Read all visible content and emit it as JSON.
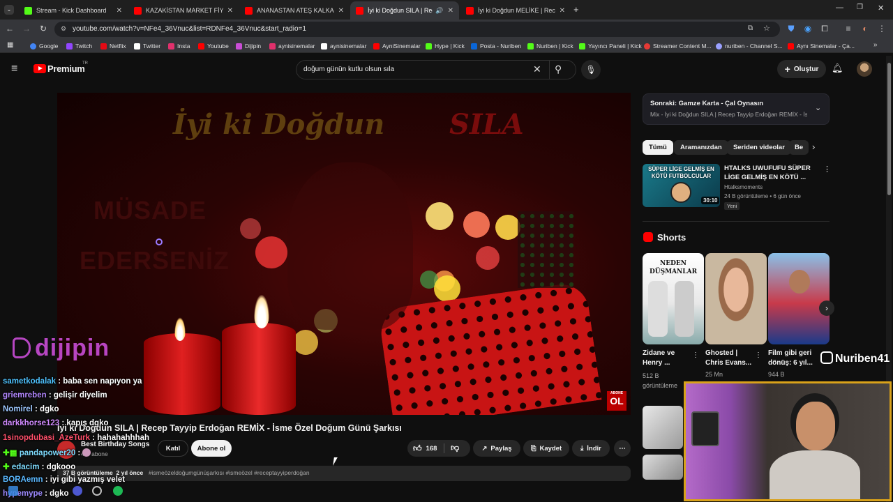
{
  "browser": {
    "tabs": [
      {
        "title": "Stream - Kick Dashboard",
        "color": "#53fc18"
      },
      {
        "title": "KAZAKİSTAN MARKET FİYATLARI",
        "color": "#ff0000"
      },
      {
        "title": "ANANASTAN ATEŞ KALKANI YAPTI",
        "color": "#ff0000"
      },
      {
        "title": "İyi ki Doğdun SILA | Recep",
        "color": "#ff0000",
        "active": true
      },
      {
        "title": "İyi ki Doğdun MELİKE | Recep Ta",
        "color": "#ff0000"
      }
    ],
    "url": "youtube.com/watch?v=NFe4_36Vnuc&list=RDNFe4_36Vnuc&start_radio=1",
    "bookmarks": [
      {
        "label": "Google",
        "color": "#4285f4"
      },
      {
        "label": "Twitch",
        "color": "#9146ff"
      },
      {
        "label": "Netflix",
        "color": "#e50914"
      },
      {
        "label": "Twitter",
        "color": "#ffffff"
      },
      {
        "label": "Insta",
        "color": "#e1306c"
      },
      {
        "label": "Youtube",
        "color": "#ff0000"
      },
      {
        "label": "Dijipin",
        "color": "#c94dd6"
      },
      {
        "label": "aynisinemalar",
        "color": "#e1306c"
      },
      {
        "label": "aynisinemalar",
        "color": "#ffffff"
      },
      {
        "label": "AyniSinemalar",
        "color": "#ff0000"
      },
      {
        "label": "Hype | Kick",
        "color": "#53fc18"
      },
      {
        "label": "Posta - Nuriben",
        "color": "#0a66d8"
      },
      {
        "label": "Nuriben | Kick",
        "color": "#53fc18"
      },
      {
        "label": "Yayıncı Paneli | Kick",
        "color": "#53fc18"
      },
      {
        "label": "Streamer Content M...",
        "color": "#e53935"
      },
      {
        "label": "nuriben - Channel S...",
        "color": "#9aa0ff"
      },
      {
        "label": "Aynı Sinemalar - Ça...",
        "color": "#ff0000"
      }
    ]
  },
  "youtube": {
    "logo": "Premium",
    "logo_badge": "TR",
    "search_query": "doğum günün kutlu olsun sıla",
    "create_label": "Oluştur",
    "video": {
      "overlay_title_1": "İyi ki Doğdun",
      "overlay_title_2": "SILA",
      "overlay_bg_text_1": "MÜSADE",
      "overlay_bg_text_2": "EDERSENİZ",
      "corner_logo_1": "ABONE",
      "corner_logo_2": "OL",
      "title": "İyi ki Doğdun SILA | Recep Tayyip Erdoğan REMİX - İsme Özel Doğum Günü Şarkısı",
      "channel": "Best Birthday Songs",
      "subscribers": "4 B abone",
      "join_label": "Katıl",
      "subscribe_label": "Abone ol",
      "likes": "168",
      "share_label": "Paylaş",
      "save_label": "Kaydet",
      "download_label": "İndir",
      "views_date": "37 B görüntüleme  2 yıl önce",
      "hashtags": "#ismeözeldoğumgünüşarkısı #ismeözel #receptayyiperdoğan"
    },
    "up_next": {
      "line1": "Sonraki: Gamze Karta - Çal Oynasın",
      "line2": "Mix - İyi ki Doğdun SILA | Recep Tayyip Erdoğan REMİX - İsme Ö..."
    },
    "chips": [
      "Tümü",
      "Aramanızdan",
      "Seriden videolar",
      "Be"
    ],
    "recommended": {
      "thumb_text": "SÜPER LİGE GELMİŞ EN KÖTÜ FUTBOLCULAR",
      "duration": "30:10",
      "title_1": "HTALKS UWUFUFU  SÜPER",
      "title_2": "LİGE GELMİŞ EN KÖTÜ ...",
      "channel": "Htalksmoments",
      "meta": "24 B görüntüleme • 6 gün önce",
      "badge": "Yeni"
    },
    "shorts": {
      "heading": "Shorts",
      "items": [
        {
          "thumb_text_1": "NEDEN",
          "thumb_text_2": "DÜŞMANLAR",
          "title_1": "Zidane ve",
          "title_2": "Henry ...",
          "meta_1": "512 B",
          "meta_2": "görüntüleme"
        },
        {
          "title_1": "Ghosted |",
          "title_2": "Chris Evans...",
          "meta_1": "25 Mn"
        },
        {
          "title_1": "Film gibi geri",
          "title_2": "dönüş: 6 yıl...",
          "meta_1": "944 B"
        }
      ]
    }
  },
  "stream_overlay": {
    "brand": "dijipin",
    "watermark": "Nuriben41",
    "chat": [
      {
        "user": "sametkodalak",
        "text": " : baba sen napıyon ya",
        "color": "#4fc3ff"
      },
      {
        "user": "griemreben",
        "text": " : gelişir diyelim",
        "color": "#b388ff"
      },
      {
        "user": "Nomirel",
        "text": " : dgko",
        "color": "#9ec8ff"
      },
      {
        "user": "darkkhorse123",
        "text": " : kapış dgko",
        "color": "#d18bff"
      },
      {
        "user": "1sinopdubasi_AzeTurk",
        "text": " : hahahahhhah",
        "color": "#ff4f6a"
      },
      {
        "user": "pandapower20",
        "text": " : ",
        "color": "#7fdcff"
      },
      {
        "user": "edacim",
        "text": " : dgkooo",
        "color": "#7fdcff"
      },
      {
        "user": "BORAemn",
        "text": " : iyi gibi yazmış velet",
        "color": "#5bb8ff"
      },
      {
        "user": "hypemype",
        "text": " : dgko",
        "color": "#9e8bff"
      }
    ]
  }
}
